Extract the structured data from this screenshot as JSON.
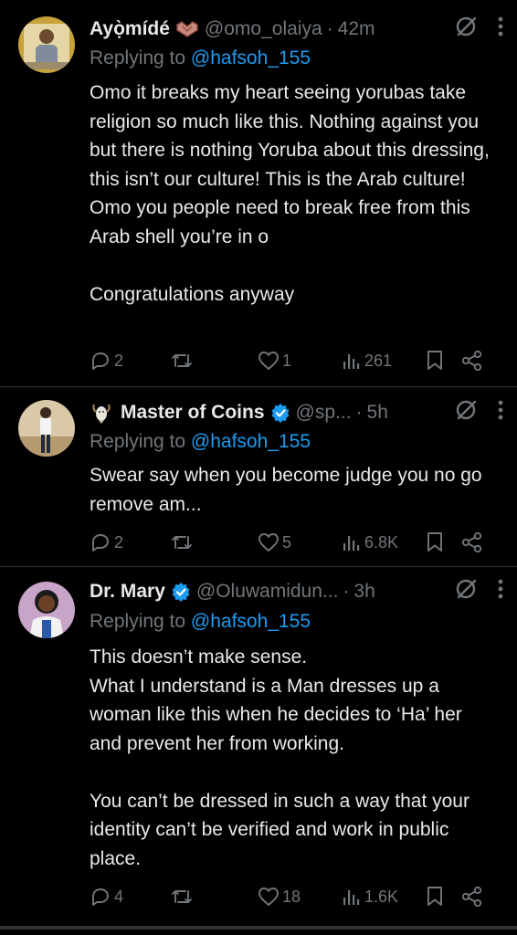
{
  "tweets": [
    {
      "name": "Ayọ̀mídé",
      "handle": "@omo_olaiya",
      "time": "42m",
      "replying_label": "Replying to",
      "replying_to": "@hafsoh_155",
      "text": "Omo it breaks my heart seeing yorubas take religion so much like this. Nothing against you but there is nothing Yoruba about this dressing, this isn’t our culture! This is the Arab culture! Omo you people need to break free from this Arab shell you’re in o\n\nCongratulations anyway",
      "replies": "2",
      "retweets": "",
      "likes": "1",
      "views": "261"
    },
    {
      "name": "Master of Coins",
      "handle": "@sp...",
      "time": "5h",
      "replying_label": "Replying to",
      "replying_to": "@hafsoh_155",
      "text": "Swear say when you become judge you no go remove am...",
      "replies": "2",
      "retweets": "",
      "likes": "5",
      "views": "6.8K"
    },
    {
      "name": "Dr. Mary",
      "handle": "@Oluwamidun...",
      "time": "3h",
      "replying_label": "Replying to",
      "replying_to": "@hafsoh_155",
      "text": "This doesn’t make sense.\nWhat I understand is a Man dresses up a woman like this when he decides to ‘Ha’ her and prevent her from working.\n\nYou can’t be dressed in such a way that your identity can’t be verified and work in public place.",
      "replies": "4",
      "retweets": "",
      "likes": "18",
      "views": "1.6K"
    }
  ],
  "colors": {
    "background": "#000000",
    "text": "#e7e9ea",
    "muted": "#71767b",
    "link": "#1d9bf0",
    "verified": "#1d9bf0"
  },
  "icons": [
    "reply-icon",
    "retweet-icon",
    "like-icon",
    "views-icon",
    "bookmark-icon",
    "share-icon",
    "grok-icon",
    "more-icon",
    "verified-icon",
    "heart-emoji-icon",
    "goat-emoji-icon"
  ]
}
